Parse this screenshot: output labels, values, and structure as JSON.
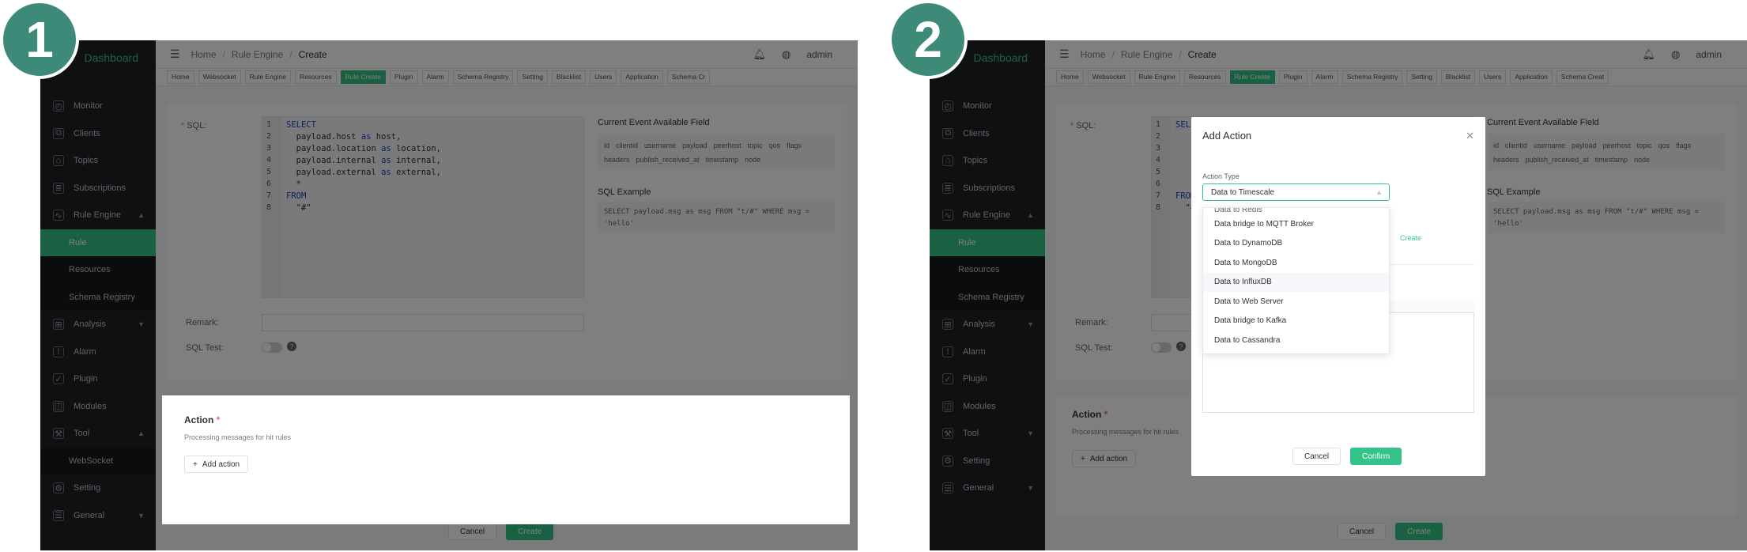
{
  "steps": [
    "1",
    "2"
  ],
  "brand": "Dashboard",
  "sidebar": {
    "items": [
      {
        "label": "Monitor",
        "icon": "monitor-icon"
      },
      {
        "label": "Clients",
        "icon": "clients-icon"
      },
      {
        "label": "Topics",
        "icon": "topics-icon"
      },
      {
        "label": "Subscriptions",
        "icon": "subscriptions-icon"
      },
      {
        "label": "Rule Engine",
        "icon": "rule-engine-icon"
      },
      {
        "label": "Rule"
      },
      {
        "label": "Resources"
      },
      {
        "label": "Schema Registry"
      },
      {
        "label": "Analysis",
        "icon": "analysis-icon"
      },
      {
        "label": "Alarm",
        "icon": "alarm-icon"
      },
      {
        "label": "Plugin",
        "icon": "plugin-icon"
      },
      {
        "label": "Modules",
        "icon": "modules-icon"
      },
      {
        "label": "Tool",
        "icon": "tool-icon"
      },
      {
        "label": "WebSocket"
      },
      {
        "label": "Setting",
        "icon": "setting-icon"
      },
      {
        "label": "General",
        "icon": "general-icon"
      }
    ]
  },
  "header": {
    "breadcrumb": [
      "Home",
      "Rule Engine",
      "Create"
    ],
    "user": "admin"
  },
  "tags": [
    "Home",
    "Websocket",
    "Rule Engine",
    "Resources",
    "Rule Create",
    "Plugin",
    "Alarm",
    "Schema Registry",
    "Setting",
    "Blacklist",
    "Users",
    "Application",
    "Schema Creat"
  ],
  "tags_p1_last": "Schema Cr",
  "sql": {
    "label": "SQL:",
    "lines": [
      "1",
      "2",
      "3",
      "4",
      "5",
      "6",
      "7",
      "8"
    ],
    "code": {
      "l1": "SELECT",
      "l2a": "  payload.host ",
      "l2b": "as",
      "l2c": " host,",
      "l3a": "  payload.location ",
      "l3b": "as",
      "l3c": " location,",
      "l4a": "  payload.internal ",
      "l4b": "as",
      "l4c": " internal,",
      "l5a": "  payload.external ",
      "l5b": "as",
      "l5c": " external,",
      "l6": "  *",
      "l7": "FROM",
      "l8": "  \"#\""
    }
  },
  "events": {
    "title": "Current Event Available Field",
    "fields": [
      "id",
      "clientid",
      "username",
      "payload",
      "peerhost",
      "topic",
      "qos",
      "flags",
      "headers",
      "publish_received_at",
      "timestamp",
      "node"
    ]
  },
  "example": {
    "title": "SQL Example",
    "line1": "SELECT payload.msg as msg FROM \"t/#\" WHERE msg =",
    "line2": "'hello'"
  },
  "form": {
    "remark_label": "Remark:",
    "sqltest_label": "SQL Test:"
  },
  "action": {
    "title": "Action",
    "required": "*",
    "subtitle": "Processing messages for hit rules",
    "add_label": "Add action"
  },
  "buttons": {
    "cancel": "Cancel",
    "create": "Create",
    "confirm": "Confirm"
  },
  "dialog": {
    "title": "Add Action",
    "type_label": "Action Type",
    "selected": "Data to Timescale",
    "create_link": "Create",
    "options": [
      "Data to Redis",
      "Data bridge to MQTT Broker",
      "Data to DynamoDB",
      "Data to MongoDB",
      "Data to InfluxDB",
      "Data to Web Server",
      "Data bridge to Kafka",
      "Data to Cassandra"
    ]
  }
}
